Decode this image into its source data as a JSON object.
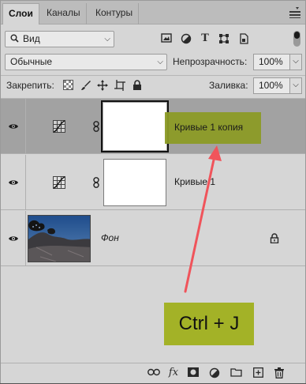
{
  "tabs": [
    {
      "label": "Слои",
      "active": true
    },
    {
      "label": "Каналы",
      "active": false
    },
    {
      "label": "Контуры",
      "active": false
    }
  ],
  "filter": {
    "kind_value": "Вид",
    "icons": [
      "image-filter-icon",
      "adjustment-filter-icon",
      "type-filter-icon",
      "shape-filter-icon",
      "smart-object-filter-icon"
    ]
  },
  "blend": {
    "mode_value": "Обычные",
    "opacity_label": "Непрозрачность:",
    "opacity_value": "100%"
  },
  "lock": {
    "label": "Закрепить:",
    "fill_label": "Заливка:",
    "fill_value": "100%"
  },
  "layers": [
    {
      "name": "Кривые 1 копия",
      "type": "curves-adjustment",
      "selected": true,
      "visible": true
    },
    {
      "name": "Кривые 1",
      "type": "curves-adjustment",
      "selected": false,
      "visible": true
    },
    {
      "name": "Фон",
      "type": "background",
      "selected": false,
      "visible": true,
      "locked": true
    }
  ],
  "callout": {
    "text": "Ctrl + J",
    "color": "#a3b227"
  },
  "colors": {
    "panel_bg": "#d6d6d6",
    "selected_row": "#a2a2a2",
    "highlight": "#8c9b26",
    "arrow": "#f0545b"
  },
  "bottom_bar_icons": [
    "link-layers-icon",
    "fx-icon",
    "add-mask-icon",
    "adjustment-layer-icon",
    "new-group-icon",
    "new-layer-icon",
    "delete-icon"
  ]
}
